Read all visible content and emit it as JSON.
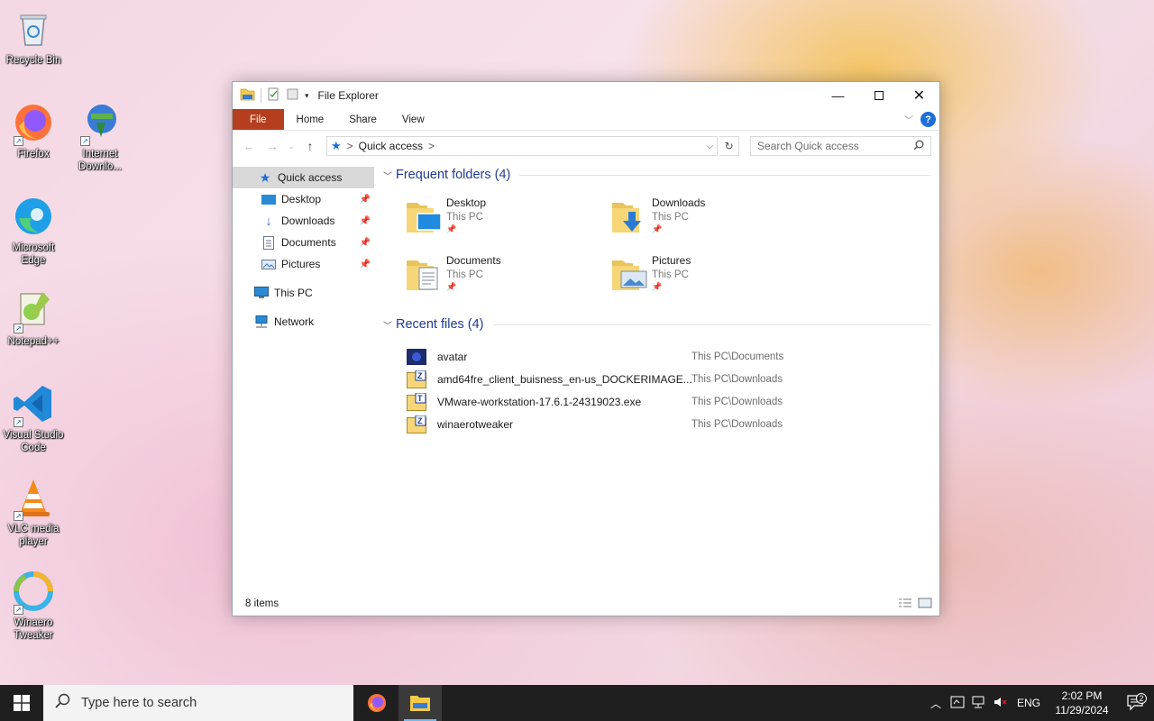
{
  "desktop": {
    "icons": [
      {
        "label": "Recycle Bin",
        "icon": "recycle-bin-icon"
      },
      {
        "label": "Firefox",
        "icon": "firefox-icon"
      },
      {
        "label": "Internet Downlo...",
        "icon": "internet-download-manager-icon"
      },
      {
        "label": "Microsoft Edge",
        "icon": "edge-icon"
      },
      {
        "label": "Notepad++",
        "icon": "notepad-plus-plus-icon"
      },
      {
        "label": "Visual Studio Code",
        "icon": "vscode-icon"
      },
      {
        "label": "VLC media player",
        "icon": "vlc-icon"
      },
      {
        "label": "Winaero Tweaker",
        "icon": "winaero-tweaker-icon"
      }
    ]
  },
  "window": {
    "title": "File Explorer",
    "ribbon_tabs": [
      "File",
      "Home",
      "Share",
      "View"
    ],
    "help_label": "?",
    "address": {
      "location": "Quick access",
      "separator": ">"
    },
    "search": {
      "placeholder": "Search Quick access"
    },
    "nav": {
      "quick_access": "Quick access",
      "pinned": [
        {
          "label": "Desktop",
          "icon": "desktop-folder-icon"
        },
        {
          "label": "Downloads",
          "icon": "downloads-folder-icon"
        },
        {
          "label": "Documents",
          "icon": "documents-folder-icon"
        },
        {
          "label": "Pictures",
          "icon": "pictures-folder-icon"
        }
      ],
      "this_pc": "This PC",
      "network": "Network"
    },
    "frequent": {
      "heading": "Frequent folders (4)",
      "folders": [
        {
          "name": "Desktop",
          "location": "This PC"
        },
        {
          "name": "Downloads",
          "location": "This PC"
        },
        {
          "name": "Documents",
          "location": "This PC"
        },
        {
          "name": "Pictures",
          "location": "This PC"
        }
      ]
    },
    "recent": {
      "heading": "Recent files (4)",
      "files": [
        {
          "name": "avatar",
          "location": "This PC\\Documents",
          "icon": "image-file-icon"
        },
        {
          "name": "amd64fre_client_buisness_en-us_DOCKERIMAGE....",
          "location": "This PC\\Downloads",
          "icon": "archive-file-icon"
        },
        {
          "name": "VMware-workstation-17.6.1-24319023.exe",
          "location": "This PC\\Downloads",
          "icon": "exe-file-icon"
        },
        {
          "name": "winaerotweaker",
          "location": "This PC\\Downloads",
          "icon": "archive-file-icon"
        }
      ]
    },
    "status": {
      "items": "8 items"
    }
  },
  "taskbar": {
    "search_placeholder": "Type here to search",
    "language": "ENG",
    "time": "2:02 PM",
    "date": "11/29/2024",
    "notification_count": "2"
  },
  "colors": {
    "file_tab": "#b43e1e",
    "accent": "#1e6fd9",
    "group_heading": "#1f3a93",
    "taskbar": "#1f1f1f"
  }
}
